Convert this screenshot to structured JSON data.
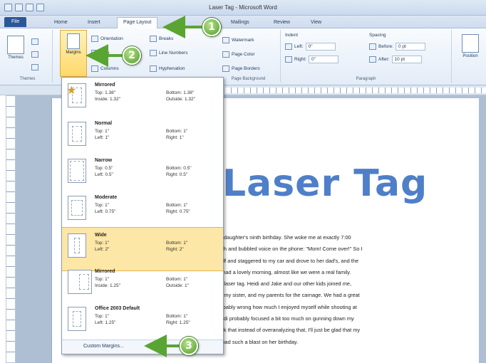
{
  "window": {
    "title": "Laser Tag - Microsoft Word"
  },
  "tabs": [
    {
      "label": "File"
    },
    {
      "label": "Home"
    },
    {
      "label": "Insert"
    },
    {
      "label": "Page Layout"
    },
    {
      "label": "Mailings"
    },
    {
      "label": "Review"
    },
    {
      "label": "View"
    }
  ],
  "ribbon": {
    "themes_label": "Themes",
    "themes_group": "Themes",
    "margins_label": "Margins",
    "orientation_label": "Orientation",
    "size_label": "Size",
    "columns_label": "Columns",
    "breaks_label": "Breaks",
    "line_numbers_label": "Line Numbers",
    "hyphenation_label": "Hyphenation",
    "watermark_label": "Watermark",
    "page_color_label": "Page Color",
    "page_borders_label": "Page Borders",
    "page_background_group": "Page Background",
    "indent_label": "Indent",
    "indent_left_label": "Left:",
    "indent_left_value": "0\"",
    "indent_right_label": "Right:",
    "indent_right_value": "0\"",
    "spacing_label": "Spacing",
    "spacing_before_label": "Before:",
    "spacing_before_value": "0 pt",
    "spacing_after_label": "After:",
    "spacing_after_value": "10 pt",
    "paragraph_group": "Paragraph",
    "position_label": "Position"
  },
  "margins_menu": {
    "options": [
      {
        "name": "Mirrored",
        "l1": "Top:     1.38\"",
        "l2": "Inside:  1.32\"",
        "r1": "Bottom: 1.38\"",
        "r2": "Outside: 1.32\""
      },
      {
        "name": "Normal",
        "l1": "Top:     1\"",
        "l2": "Left:    1\"",
        "r1": "Bottom: 1\"",
        "r2": "Right:   1\""
      },
      {
        "name": "Narrow",
        "l1": "Top:     0.5\"",
        "l2": "Left:    0.5\"",
        "r1": "Bottom: 0.5\"",
        "r2": "Right:   0.5\""
      },
      {
        "name": "Moderate",
        "l1": "Top:     1\"",
        "l2": "Left:    0.75\"",
        "r1": "Bottom: 1\"",
        "r2": "Right:   0.75\""
      },
      {
        "name": "Wide",
        "l1": "Top:     1\"",
        "l2": "Left:    2\"",
        "r1": "Bottom: 1\"",
        "r2": "Right:   2\""
      },
      {
        "name": "Mirrored",
        "l1": "Top:     1\"",
        "l2": "Inside:  1.25\"",
        "r1": "Bottom: 1\"",
        "r2": "Outside: 1\""
      },
      {
        "name": "Office 2003 Default",
        "l1": "Top:     1\"",
        "l2": "Left:    1.25\"",
        "r1": "Bottom: 1\"",
        "r2": "Right:   1.25\""
      }
    ],
    "custom": "Custom Margins..."
  },
  "document": {
    "title": "Laser Tag",
    "lines": [
      "my daughter's ninth birthday. She woke me at exactly 7:00",
      "eech and bubbled voice on the phone: \"Mom! Come over!\" So I",
      "yself and staggered to my car and drove to her dad's, and the",
      "ou had a lovely morning, almost like we were a real family.",
      "eat laser tag. Heidi and Jake and our other kids joined me,",
      "ad, my sister, and my parents for the carnage. We had a great",
      "probably wrong how much I enjoyed myself while shooting at",
      "Jandi probably focused a bit too much on gunning down my",
      "think that instead of overanalyzing that, I'll just be glad that my",
      "ild had such a blast on her birthday."
    ]
  },
  "callouts": {
    "one": "1",
    "two": "2",
    "three": "3"
  }
}
